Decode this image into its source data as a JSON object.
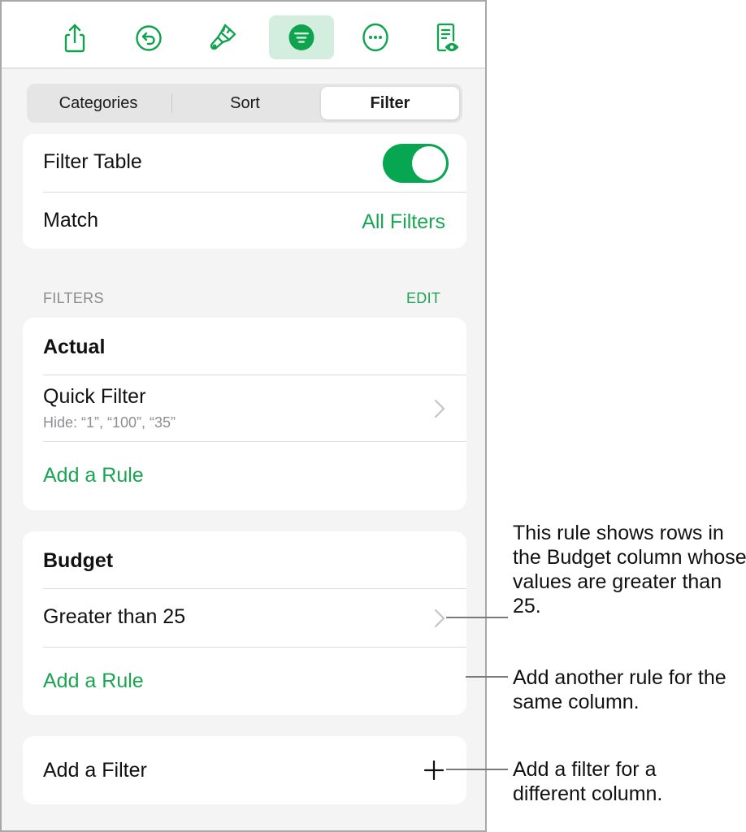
{
  "toolbar": {
    "buttons": [
      {
        "name": "share",
        "icon": "share-icon"
      },
      {
        "name": "undo",
        "icon": "undo-icon"
      },
      {
        "name": "format",
        "icon": "paintbrush-icon"
      },
      {
        "name": "organize",
        "icon": "filter-icon",
        "active": true
      },
      {
        "name": "more",
        "icon": "more-icon"
      },
      {
        "name": "reading-view",
        "icon": "document-eye-icon"
      }
    ]
  },
  "tabs": {
    "items": [
      "Categories",
      "Sort",
      "Filter"
    ],
    "selected": "Filter"
  },
  "settings": {
    "filter_table_label": "Filter Table",
    "filter_table_on": true,
    "match_label": "Match",
    "match_value": "All Filters"
  },
  "filters_section": {
    "header": "FILTERS",
    "edit_label": "EDIT",
    "groups": [
      {
        "column": "Actual",
        "rules": [
          {
            "title": "Quick Filter",
            "subtitle": "Hide: “1”, “100”, “35”"
          }
        ],
        "add_rule_label": "Add a Rule"
      },
      {
        "column": "Budget",
        "rules": [
          {
            "title": "Greater than 25"
          }
        ],
        "add_rule_label": "Add a Rule"
      }
    ],
    "add_filter_label": "Add a Filter"
  },
  "callouts": [
    "This rule shows rows in the Budget column whose values are greater than 25.",
    "Add another rule for the same column.",
    "Add a filter for a different column."
  ],
  "colors": {
    "accent": "#1aa553",
    "toggle_on": "#07a650",
    "active_tool_bg": "#d3eedf"
  }
}
